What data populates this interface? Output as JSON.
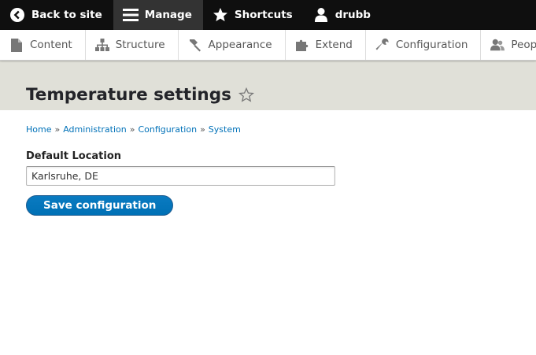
{
  "toolbar": {
    "back_label": "Back to site",
    "manage_label": "Manage",
    "shortcuts_label": "Shortcuts",
    "user_label": "drubb"
  },
  "tray": {
    "items": [
      {
        "label": "Content",
        "icon": "file-icon"
      },
      {
        "label": "Structure",
        "icon": "sitemap-icon"
      },
      {
        "label": "Appearance",
        "icon": "brush-icon"
      },
      {
        "label": "Extend",
        "icon": "puzzle-icon"
      },
      {
        "label": "Configuration",
        "icon": "wrench-icon"
      },
      {
        "label": "People",
        "icon": "people-icon"
      }
    ]
  },
  "page": {
    "title": "Temperature settings"
  },
  "breadcrumb": {
    "items": [
      "Home",
      "Administration",
      "Configuration",
      "System"
    ],
    "separator": "»"
  },
  "form": {
    "default_location_label": "Default Location",
    "default_location_value": "Karlsruhe, DE",
    "submit_label": "Save configuration"
  },
  "colors": {
    "toolbar_bg": "#0f0f0f",
    "active_tab_bg": "#333333",
    "header_bg": "#e0e0d8",
    "link": "#0071b8",
    "primary_button": "#0071b8"
  }
}
